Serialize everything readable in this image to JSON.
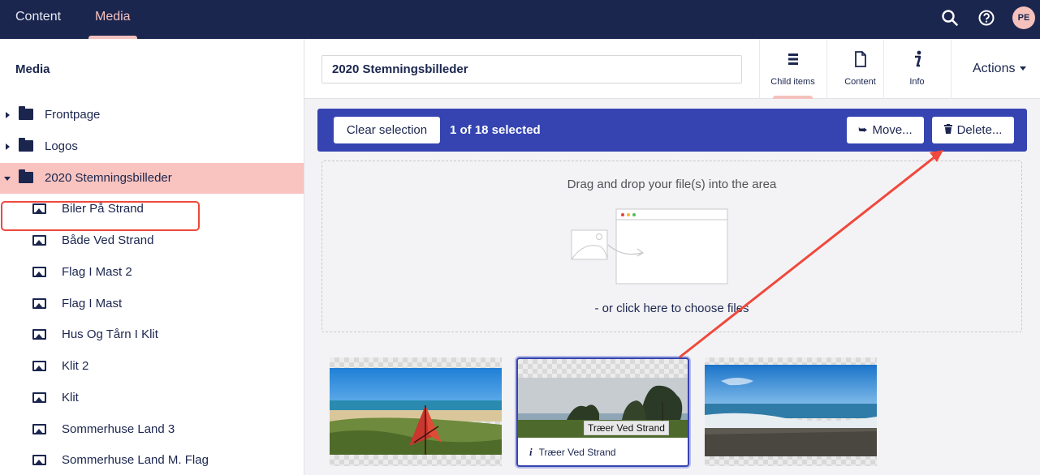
{
  "header": {
    "nav": [
      "Content",
      "Media"
    ],
    "active_nav": "Media",
    "user_initials": "PE"
  },
  "sidebar": {
    "title": "Media",
    "folders": [
      "Frontpage",
      "Logos",
      "2020 Stemningsbilleder"
    ],
    "selected_folder": "2020 Stemningsbilleder",
    "children": [
      "Biler På Strand",
      "Både Ved Strand",
      "Flag I Mast 2",
      "Flag I Mast",
      "Hus Og Tårn I Klit",
      "Klit 2",
      "Klit",
      "Sommerhuse Land 3",
      "Sommerhuse Land M. Flag"
    ]
  },
  "editor": {
    "name_value": "2020 Stemningsbilleder",
    "tabs": [
      "Child items",
      "Content",
      "Info"
    ],
    "active_tab": "Child items",
    "actions_label": "Actions"
  },
  "selection_bar": {
    "clear_label": "Clear selection",
    "count_text": "1 of 18 selected",
    "move_label": "Move...",
    "delete_label": "Delete..."
  },
  "dropzone": {
    "text": "Drag and drop your file(s) into the area",
    "subtext": "- or click here to choose files"
  },
  "items": [
    {
      "caption": ""
    },
    {
      "caption": "Træer Ved Strand",
      "tooltip": "Træer Ved Strand"
    },
    {
      "caption": ""
    }
  ],
  "colors": {
    "header_bg": "#1b264f",
    "accent_pink": "#f5c1bc",
    "selection_bar": "#3544b1",
    "annotation_red": "#f0483c"
  }
}
